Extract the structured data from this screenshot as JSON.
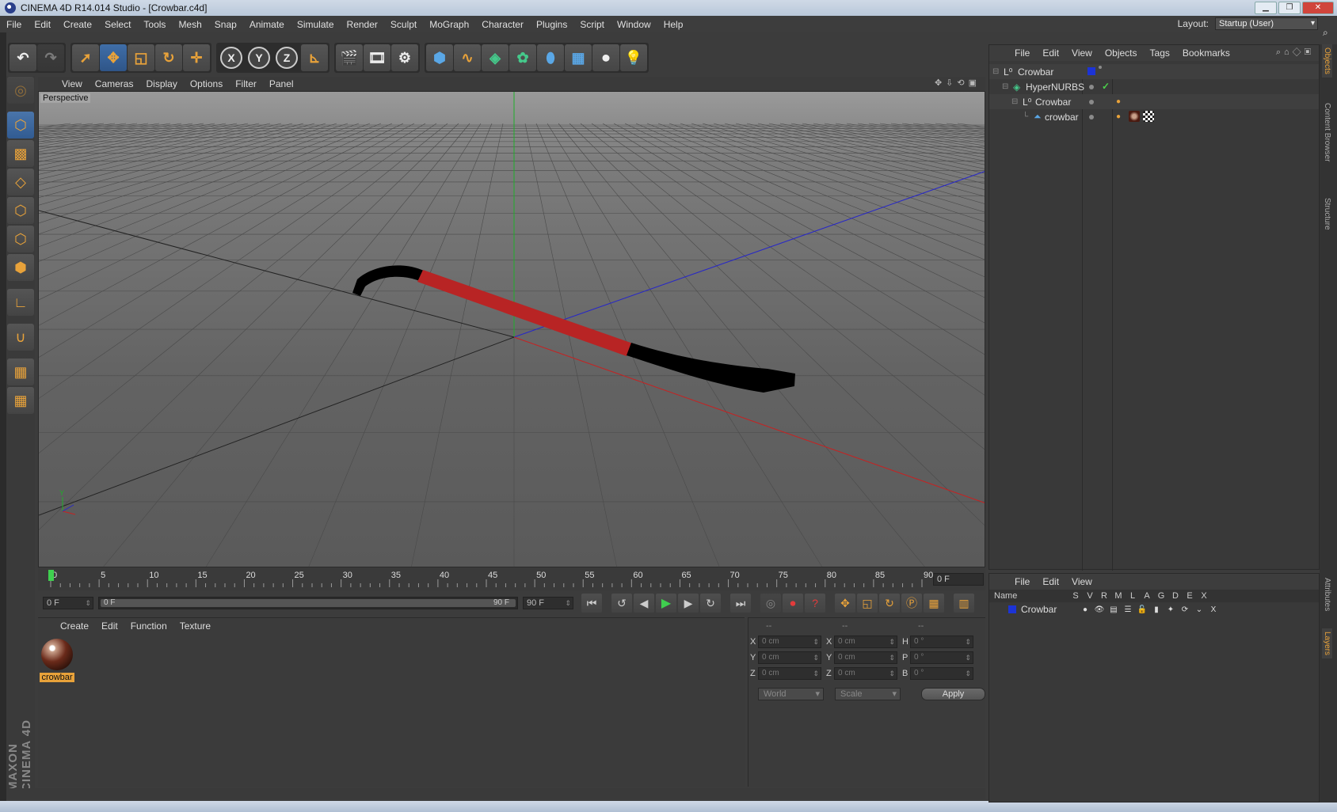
{
  "window": {
    "title": "CINEMA 4D R14.014 Studio - [Crowbar.c4d]"
  },
  "menubar": {
    "items": [
      "File",
      "Edit",
      "Create",
      "Select",
      "Tools",
      "Mesh",
      "Snap",
      "Animate",
      "Simulate",
      "Render",
      "Sculpt",
      "MoGraph",
      "Character",
      "Plugins",
      "Script",
      "Window",
      "Help"
    ],
    "layout_label": "Layout:",
    "layout_value": "Startup (User)"
  },
  "toolbar": {
    "icons": [
      "undo-icon",
      "redo-icon",
      "live-selection-icon",
      "move-icon",
      "scale-icon",
      "rotate-icon",
      "recent-tool-icon",
      "x-axis-icon",
      "y-axis-icon",
      "z-axis-icon",
      "coordinate-system-icon",
      "render-view-icon",
      "render-picture-viewer-icon",
      "edit-render-settings-icon",
      "cube-icon",
      "spline-pen-icon",
      "nurbs-icon",
      "array-icon",
      "deformer-icon",
      "floor-icon",
      "camera-icon",
      "light-icon"
    ],
    "axis_labels": [
      "X",
      "Y",
      "Z"
    ]
  },
  "viewport": {
    "menu": [
      "View",
      "Cameras",
      "Display",
      "Options",
      "Filter",
      "Panel"
    ],
    "label": "Perspective",
    "object_colors": {
      "handle": "#000000",
      "grip": "#b82424"
    }
  },
  "timeline": {
    "ticks": [
      "0",
      "5",
      "10",
      "15",
      "20",
      "25",
      "30",
      "35",
      "40",
      "45",
      "50",
      "55",
      "60",
      "65",
      "70",
      "75",
      "80",
      "85",
      "90"
    ],
    "current_frame": "0 F"
  },
  "transport": {
    "start": "0 F",
    "range_start": "0 F",
    "range_end": "90 F",
    "end": "90 F"
  },
  "material_manager": {
    "menu": [
      "Create",
      "Edit",
      "Function",
      "Texture"
    ],
    "materials": [
      {
        "name": "crowbar"
      }
    ]
  },
  "coordinates": {
    "headers": [
      "--",
      "--",
      "--"
    ],
    "rows": [
      {
        "a": "X",
        "pos": "0 cm",
        "b": "X",
        "size": "0 cm",
        "c": "H",
        "rot": "0 °"
      },
      {
        "a": "Y",
        "pos": "0 cm",
        "b": "Y",
        "size": "0 cm",
        "c": "P",
        "rot": "0 °"
      },
      {
        "a": "Z",
        "pos": "0 cm",
        "b": "Z",
        "size": "0 cm",
        "c": "B",
        "rot": "0 °"
      }
    ],
    "mode": "World",
    "transform": "Scale",
    "apply": "Apply"
  },
  "object_manager": {
    "menu": [
      "File",
      "Edit",
      "View",
      "Objects",
      "Tags",
      "Bookmarks"
    ],
    "objects": [
      {
        "name": "Crowbar",
        "type": "null-object-icon"
      },
      {
        "name": "HyperNURBS",
        "type": "hypernurbs-icon"
      },
      {
        "name": "Crowbar",
        "type": "null-object-icon"
      },
      {
        "name": "crowbar",
        "type": "polygon-object-icon"
      }
    ],
    "layer_color": "#1c33d6"
  },
  "layer_manager": {
    "menu": [
      "File",
      "Edit",
      "View"
    ],
    "columns": [
      "Name",
      "S",
      "V",
      "R",
      "M",
      "L",
      "A",
      "G",
      "D",
      "E",
      "X"
    ],
    "layers": [
      {
        "name": "Crowbar",
        "color": "#1c33d6"
      }
    ]
  },
  "right_tabs": [
    "Objects",
    "Content Browser",
    "Structure",
    "Attributes",
    "Layers"
  ],
  "branding": "MAXON CINEMA 4D"
}
